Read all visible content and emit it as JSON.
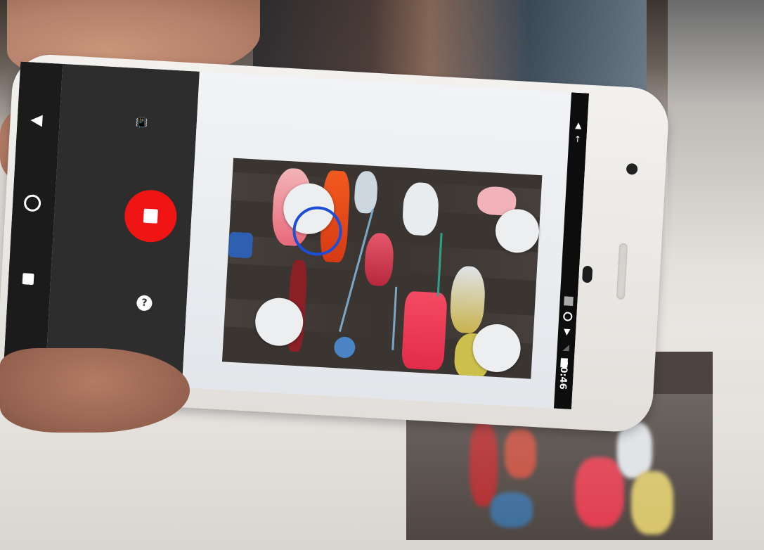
{
  "status_bar": {
    "time": "10:46",
    "icons": [
      "battery-icon",
      "wifi-icon",
      "signal-icon",
      "alarm-icon",
      "image-icon",
      "notification-icon",
      "upload-icon"
    ]
  },
  "navigation": {
    "icons": [
      "back-icon",
      "home-icon",
      "recents-icon"
    ]
  },
  "controls": {
    "vibrate_icon": "vibrate-icon",
    "record_button_icon": "stop-icon",
    "help_label": "?"
  },
  "colors": {
    "record_red": "#f11414",
    "cursor_blue": "#1c4fd6",
    "target_white": "#eceef0"
  }
}
